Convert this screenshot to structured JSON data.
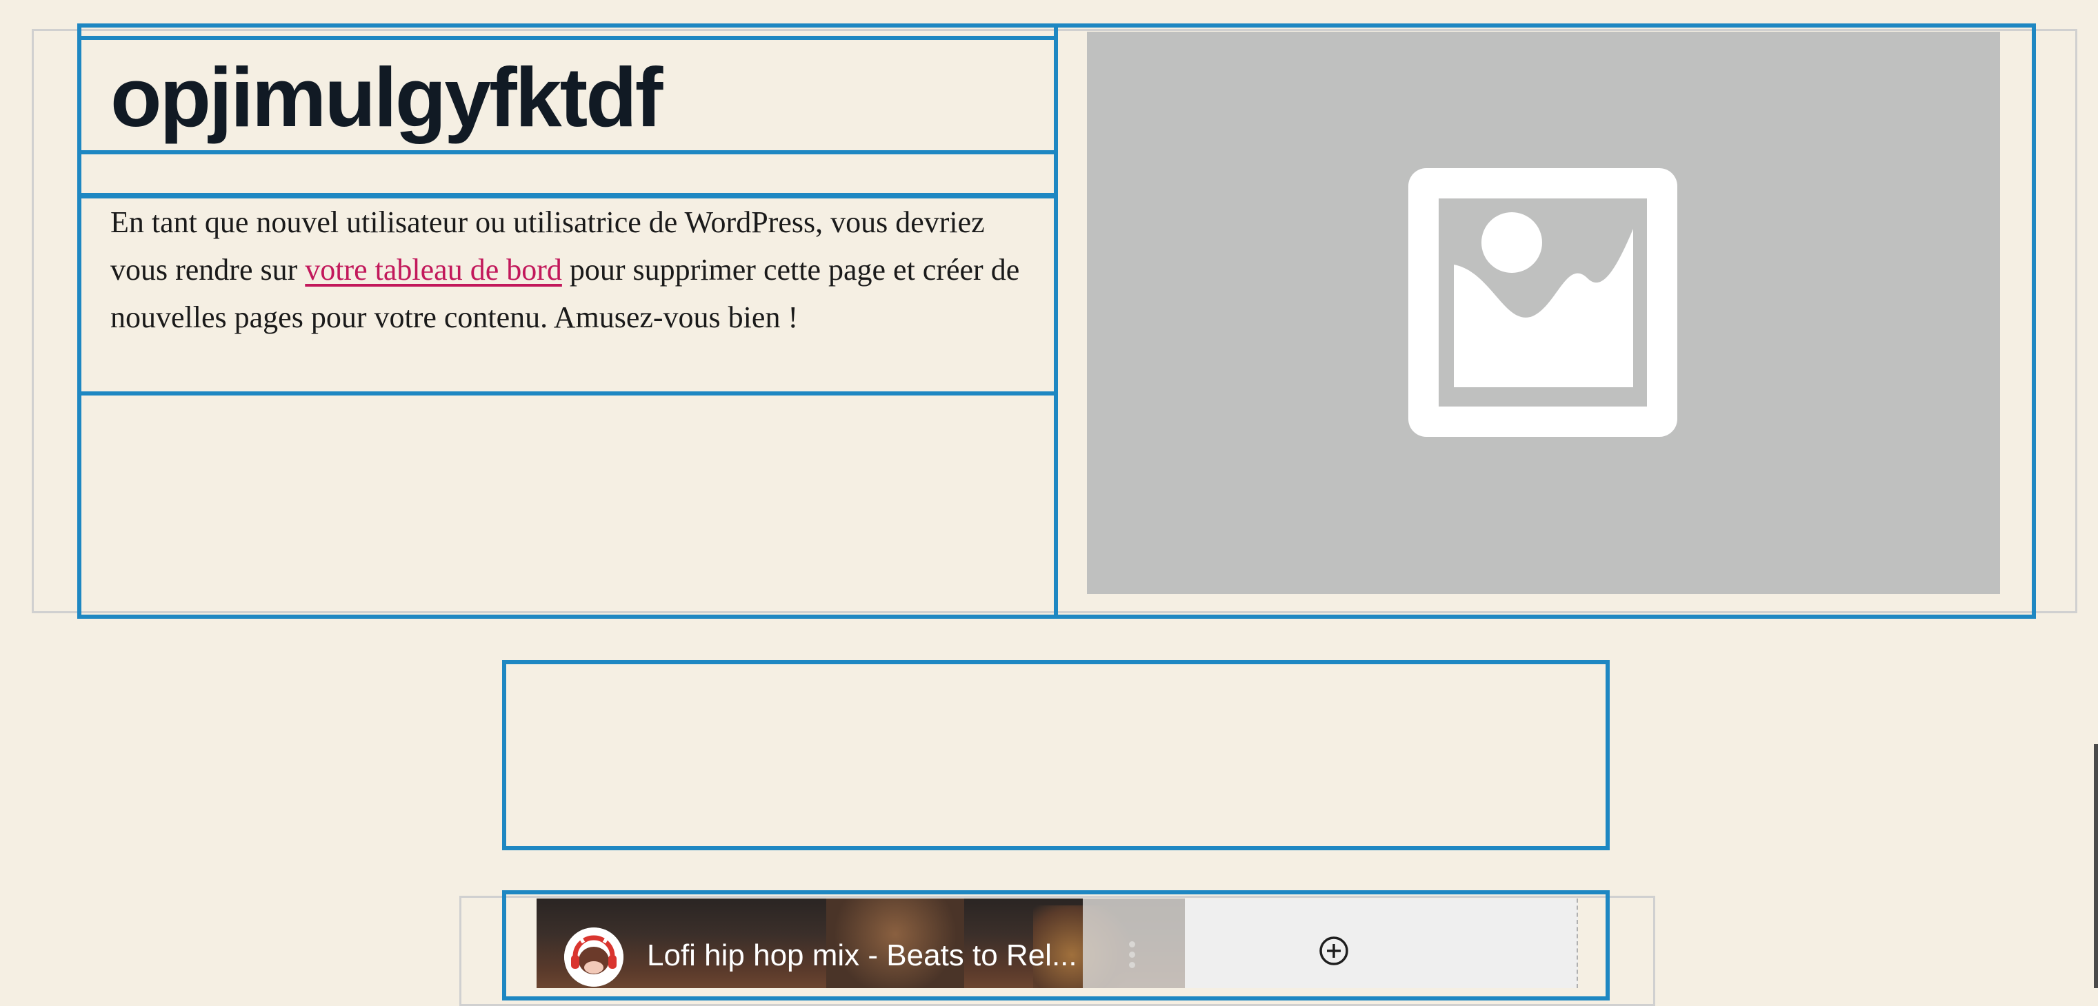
{
  "columns_block": {
    "heading": "opjimulgyfktdf",
    "paragraph": {
      "before_link": "En tant que nouvel utilisateur ou utilisatrice de WordPress, vous devriez vous rendre sur ",
      "link_text": "votre tableau de bord",
      "after_link": " pour supprimer cette page et créer de nouvelles pages pour votre contenu. Amusez-vous bien !"
    },
    "image_placeholder_icon": "image-placeholder-icon"
  },
  "video_embed": {
    "title": "Lofi hip hop mix - Beats to Rel...",
    "channel_avatar_icon": "cow-headphones-avatar-icon",
    "more_icon": "kebab-menu-icon",
    "add_icon": "plus-circle-icon"
  },
  "colors": {
    "background": "#f5efe3",
    "block_outline": "#1e87c2",
    "link": "#c2185b",
    "placeholder": "#bfc0bf"
  }
}
